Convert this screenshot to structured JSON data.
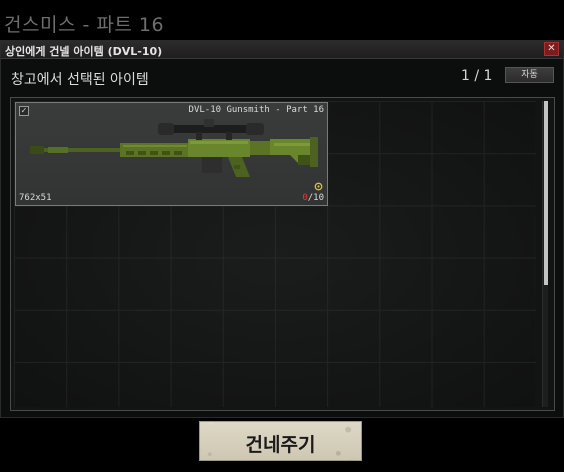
{
  "page_title": "건스미스 - 파트 16",
  "window": {
    "title": "상인에게 건넬 아이템 (DVL-10)",
    "close_label": "✕"
  },
  "stash": {
    "label": "창고에서 선택된 아이템",
    "page_indicator": "1 / 1",
    "auto_label": "자동"
  },
  "item": {
    "name": "DVL-10 Gunsmith - Part 16",
    "caliber": "762x51",
    "mag_current": "0",
    "mag_capacity": "/10",
    "checked": true,
    "icon": "rifle-icon",
    "colors": {
      "body": "#5c7326",
      "body_dark": "#3f5218"
    }
  },
  "actions": {
    "give_label": "건네주기"
  },
  "colors": {
    "accent": "#7c1d1d",
    "mag_empty": "#e13a3a",
    "button_bg": "#d8d2be"
  }
}
